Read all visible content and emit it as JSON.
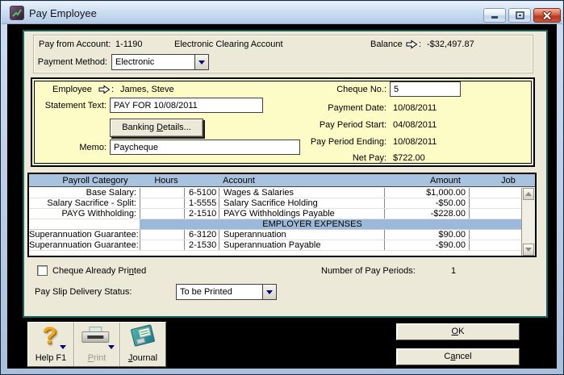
{
  "window": {
    "title": "Pay Employee"
  },
  "header": {
    "pay_from_account_label": "Pay from Account:",
    "account_number": "1-1190",
    "account_name": "Electronic Clearing Account",
    "balance_label": "Balance",
    "balance_colon": ":",
    "balance_value": "-$32,497.87",
    "payment_method_label": "Payment Method:",
    "payment_method_value": "Electronic"
  },
  "details": {
    "employee_label": "Employee",
    "employee_colon": ":",
    "employee_value": "James, Steve",
    "statement_text_label": "Statement Text:",
    "statement_text_value": "PAY FOR 10/08/2011",
    "banking_details_button": {
      "pre": "Banking ",
      "key": "D",
      "post": "etails..."
    },
    "memo_label": "Memo:",
    "memo_value": "Paycheque",
    "cheque_no_label": "Cheque No.:",
    "cheque_no_value": "5",
    "payment_date_label": "Payment Date:",
    "payment_date_value": "10/08/2011",
    "pay_period_start_label": "Pay Period Start:",
    "pay_period_start_value": "04/08/2011",
    "pay_period_ending_label": "Pay Period Ending:",
    "pay_period_ending_value": "10/08/2011",
    "net_pay_label": "Net Pay:",
    "net_pay_value": "$722.00"
  },
  "table": {
    "headers": {
      "category": "Payroll Category",
      "hours": "Hours",
      "account": "Account",
      "amount": "Amount",
      "job": "Job"
    },
    "rows": [
      {
        "category": "Base Salary:",
        "hours": "",
        "account_no": "6-5100",
        "account_name": "Wages & Salaries",
        "amount": "$1,000.00",
        "job": ""
      },
      {
        "category": "Salary Sacrifice - Split:",
        "hours": "",
        "account_no": "1-5555",
        "account_name": "Salary Sacrifice Holding",
        "amount": "-$50.00",
        "job": ""
      },
      {
        "category": "PAYG Withholding:",
        "hours": "",
        "account_no": "2-1510",
        "account_name": "PAYG Withholdings Payable",
        "amount": "-$228.00",
        "job": ""
      },
      {
        "category": "Superannuation Guarantee:",
        "hours": "",
        "account_no": "6-3120",
        "account_name": "Superannuation",
        "amount": "$90.00",
        "job": ""
      },
      {
        "category": "Superannuation Guarantee:",
        "hours": "",
        "account_no": "2-1530",
        "account_name": "Superannuation Payable",
        "amount": "-$90.00",
        "job": ""
      }
    ],
    "section_header": "EMPLOYER EXPENSES"
  },
  "footer": {
    "cheque_printed": {
      "pre": "Cheque Already Pri",
      "key": "n",
      "post": "ted"
    },
    "pay_periods_label": "Number of Pay Periods:",
    "pay_periods_value": "1",
    "delivery_status_label": "Pay Slip Delivery Status:",
    "delivery_status_value": "To be Printed"
  },
  "toolbar": {
    "help_label": "Help F1",
    "print": {
      "pre": "",
      "key": "P",
      "post": "rint"
    },
    "journal": {
      "pre": "",
      "key": "J",
      "post": "ournal"
    }
  },
  "actions": {
    "ok": {
      "pre": "",
      "key": "O",
      "post": "K"
    },
    "cancel": {
      "pre": "C",
      "key": "a",
      "post": "ncel"
    }
  },
  "colors": {
    "panel_accent_teal": "#19615f",
    "highlight_yellow": "#fdfbc6",
    "table_header_blue": "#a9c2de",
    "section_band_blue": "#9db9da",
    "close_button_red": "#b93722"
  }
}
